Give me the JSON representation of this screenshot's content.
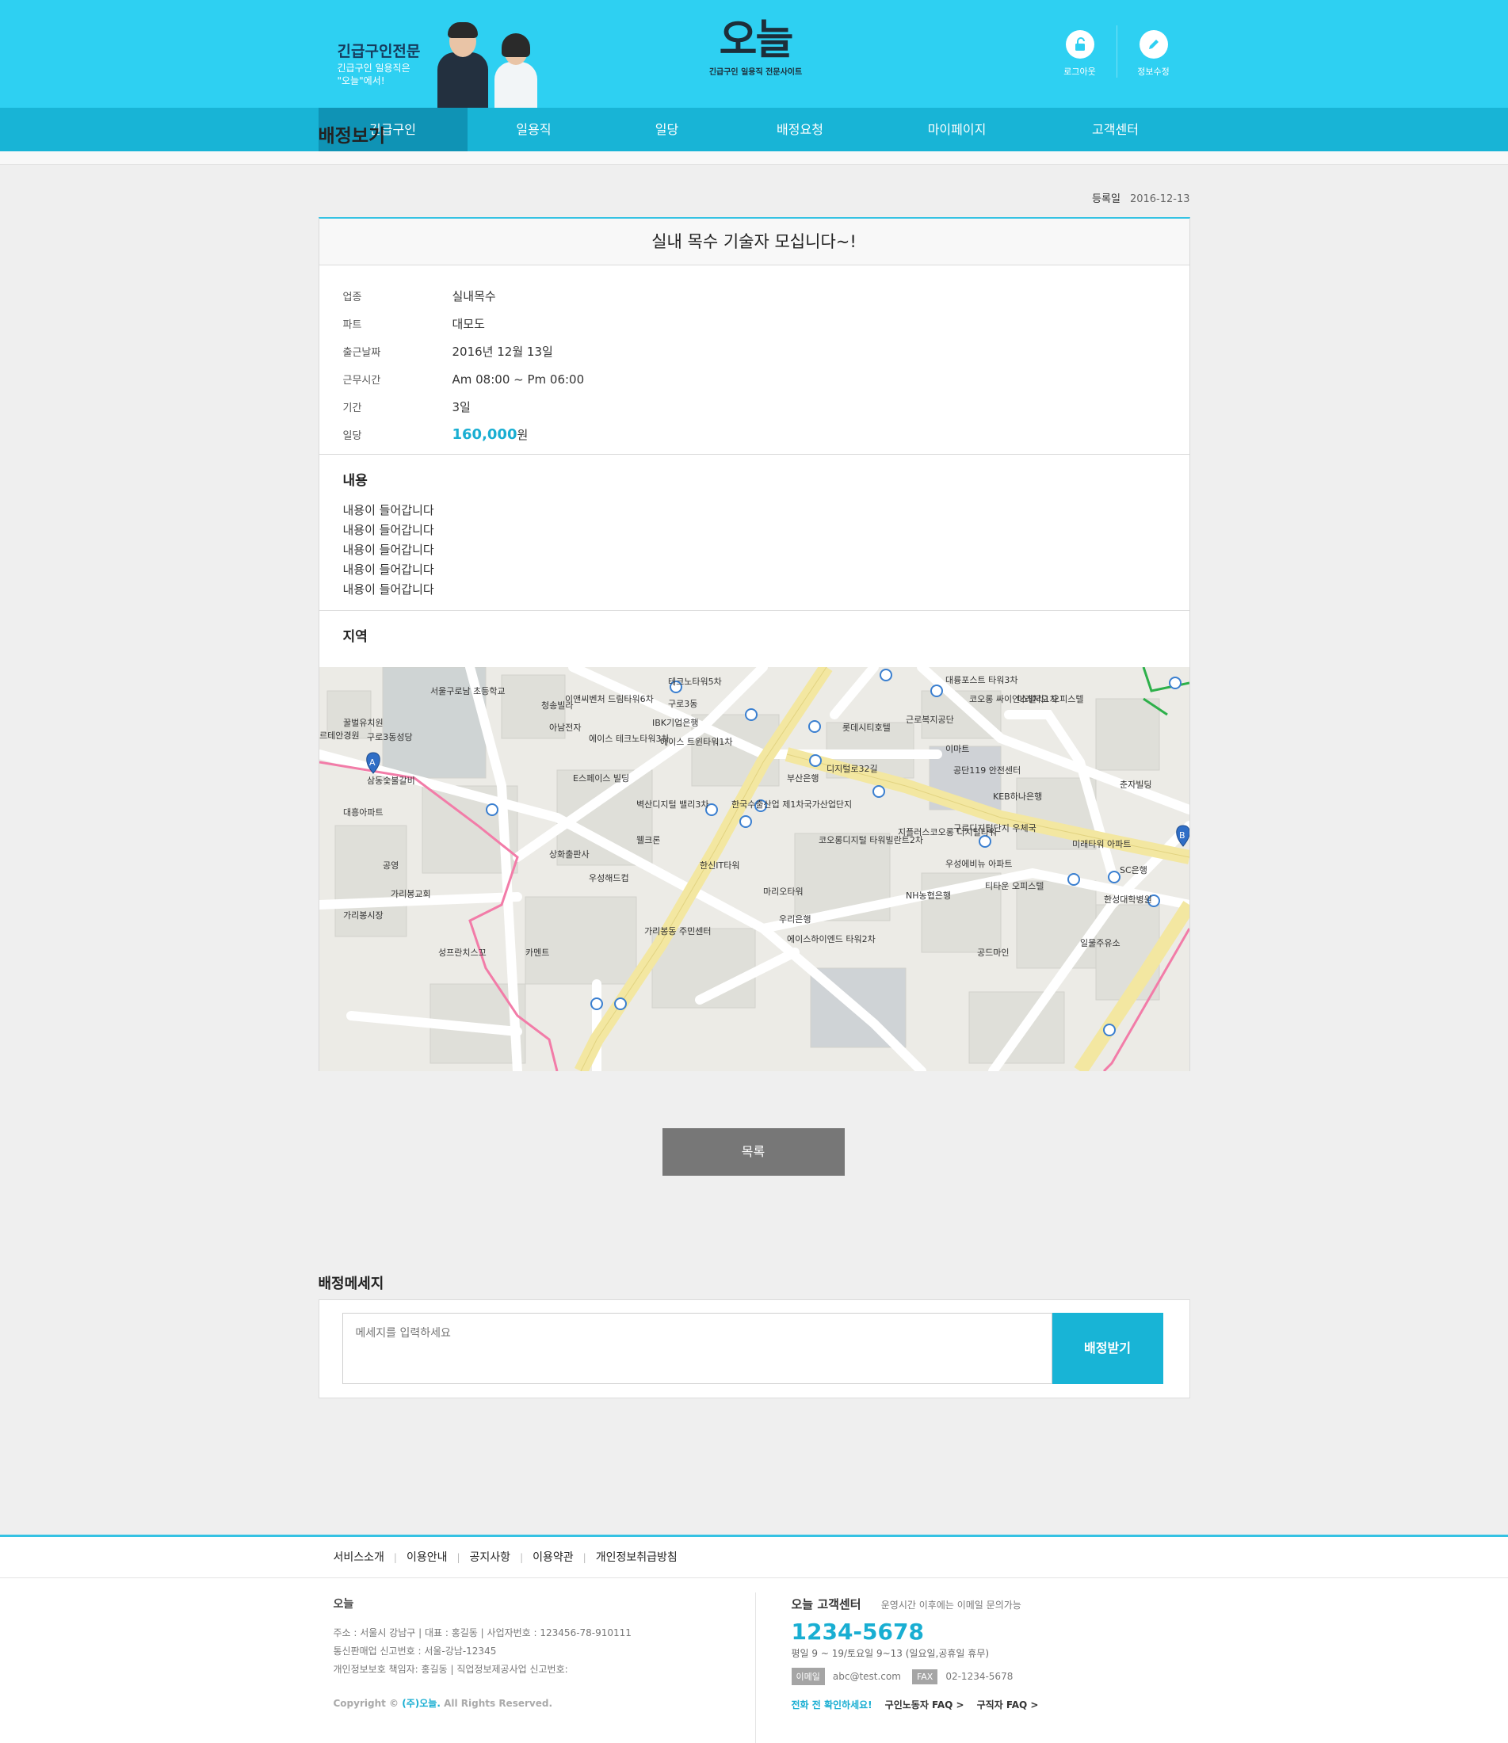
{
  "header": {
    "banner_title": "긴급구인전문",
    "banner_sub": "긴급구인 일용직은\n\"오늘\"에서!",
    "logo": "오늘",
    "logo_tagline": "긴급구인 일용직 전문사이트",
    "util": [
      {
        "label": "로그아웃",
        "icon": "unlock-icon"
      },
      {
        "label": "정보수정",
        "icon": "pencil-icon"
      }
    ]
  },
  "nav": [
    {
      "label": "긴급구인",
      "active": true
    },
    {
      "label": "일용직"
    },
    {
      "label": "일당"
    },
    {
      "label": "배정요청"
    },
    {
      "label": "마이페이지"
    },
    {
      "label": "고객센터"
    }
  ],
  "page_title": "배정보기",
  "reg_label": "등록일",
  "reg_date": "2016-12-13",
  "post": {
    "title": "실내 목수 기술자 모십니다~!",
    "fields": [
      {
        "key": "업종",
        "value": "실내목수"
      },
      {
        "key": "파트",
        "value": "대모도"
      },
      {
        "key": "출근날짜",
        "value": "2016년 12월 13일"
      },
      {
        "key": "근무시간",
        "value": "Am 08:00 ~ Pm 06:00"
      },
      {
        "key": "기간",
        "value": "3일"
      }
    ],
    "wage_key": "일당",
    "wage_value": "160,000",
    "wage_unit": "원",
    "content_heading": "내용",
    "content_lines": [
      "내용이 들어갑니다",
      "내용이 들어갑니다",
      "내용이 들어갑니다",
      "내용이 들어갑니다",
      "내용이 들어갑니다"
    ],
    "region_heading": "지역"
  },
  "map": {
    "labels": [
      "테크노타워5차",
      "대륭포스트 타워3차",
      "이앤씨벤처 드림타워6차",
      "서울구로남 초등학교",
      "꿀벌유치원",
      "구로3동성당",
      "르테안경원",
      "IBK기업은행",
      "에이스 테크노타워3차",
      "에이스 트윈타워1차",
      "롯데시티호텔",
      "코오롱 싸이언스밸리1차",
      "미래지오 오피스텔",
      "근로복지공단",
      "이마트",
      "공단119 안전센터",
      "KEB하나은행",
      "한국수출산업 제1차국가산업단지",
      "E스페이스 빌딩",
      "벽산디지털 밸리3차",
      "부산은행",
      "지플러스코오롱 디지털타워",
      "구로디지털단지 우체국",
      "코오롱디지털 타워빌란트2차",
      "웰크론",
      "상화출판사",
      "한신IT타워",
      "우성해드컵",
      "가리봉교회",
      "가리봉시장",
      "마리오타워",
      "NH농협은행",
      "우성에비뉴 아파트",
      "티타운 오피스텔",
      "미래타워 아파트",
      "SC은행",
      "한성대학병원",
      "가리봉동 주민센터",
      "우리은행",
      "에이스하이엔드 타워2차",
      "공드마인",
      "성프란치스꼬",
      "카멘트",
      "일물주유소",
      "춘자빌딩",
      "삼동숯불갈비",
      "대흥아파트",
      "공영",
      "청송빌라",
      "아남전자",
      "구로3동",
      "디지털로32길"
    ],
    "markers": [
      "A",
      "B"
    ]
  },
  "list_button": "목록",
  "message": {
    "title": "배정메세지",
    "placeholder": "메세지를 입력하세요",
    "submit": "배정받기"
  },
  "footer": {
    "links": [
      "서비스소개",
      "이용안내",
      "공지사항",
      "이용약관",
      "개인정보취급방침"
    ],
    "company": "오늘",
    "address_line": "주소 : 서울시 강남구  |  대표 : 홍길동  |  사업자번호 : 123456-78-910111",
    "sales_line": "통신판매업 신고번호 : 서울-강남-12345",
    "privacy_line": "개인정보보호 책임자: 홍길동 | 직업정보제공사업 신고번호:",
    "copyright_prefix": "Copyright ©",
    "copyright_name": "(주)오늘.",
    "copyright_suffix": "All Rights Reserved.",
    "cs_title": "오늘 고객센터",
    "cs_note": "운영시간 이후에는 이메일 문의가능",
    "tel": "1234-5678",
    "hours": "평일 9 ~ 19/토요일 9~13 (일요일,공휴일 휴무)",
    "email_label": "이메일",
    "email": "abc@test.com",
    "fax_label": "FAX",
    "fax": "02-1234-5678",
    "confirm": "전화 전 확인하세요!",
    "faq1": "구인노동자 FAQ >",
    "faq2": "구직자 FAQ >"
  },
  "colors": {
    "primary": "#2ed0f2",
    "nav": "#18b4d6",
    "nav_active": "#0f93b5",
    "accent": "#19aed2"
  }
}
